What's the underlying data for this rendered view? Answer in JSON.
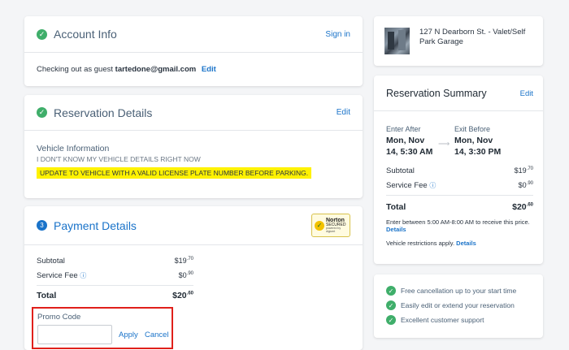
{
  "account": {
    "title": "Account Info",
    "signin": "Sign in",
    "guest_prefix": "Checking out as guest",
    "email": "tartedone@gmail.com",
    "edit": "Edit"
  },
  "reservation": {
    "title": "Reservation Details",
    "edit": "Edit",
    "vehicle_heading": "Vehicle Information",
    "vehicle_text": "I DON'T KNOW MY VEHICLE DETAILS RIGHT NOW",
    "warning": "UPDATE TO VEHICLE WITH A VALID LICENSE PLATE NUMBER BEFORE PARKING."
  },
  "payment": {
    "step": "3",
    "title": "Payment Details",
    "norton_line1": "Norton",
    "norton_line2": "SECURED",
    "norton_line3": "powered by digicert",
    "subtotal_label": "Subtotal",
    "subtotal_main": "$19",
    "subtotal_cents": ".70",
    "fee_label": "Service Fee",
    "fee_main": "$0",
    "fee_cents": ".90",
    "total_label": "Total",
    "total_main": "$20",
    "total_cents": ".60",
    "promo_label": "Promo Code",
    "promo_value": "",
    "apply": "Apply",
    "cancel": "Cancel"
  },
  "location": {
    "address": "127 N Dearborn St. - Valet/Self Park Garage"
  },
  "summary": {
    "title": "Reservation Summary",
    "edit": "Edit",
    "enter_label": "Enter After",
    "enter_date": "Mon, Nov 14, 5:30 AM",
    "exit_label": "Exit Before",
    "exit_date": "Mon, Nov 14, 3:30 PM",
    "subtotal_label": "Subtotal",
    "subtotal_main": "$19",
    "subtotal_cents": ".70",
    "fee_label": "Service Fee",
    "fee_main": "$0",
    "fee_cents": ".90",
    "total_label": "Total",
    "total_main": "$20",
    "total_cents": ".60",
    "note": "Enter between 5:00 AM-8:00 AM to receive this price.",
    "note_link": "Details",
    "restrictions": "Vehicle restrictions apply.",
    "restrictions_link": "Details"
  },
  "benefits": [
    "Free cancellation up to your start time",
    "Easily edit or extend your reservation",
    "Excellent customer support"
  ]
}
